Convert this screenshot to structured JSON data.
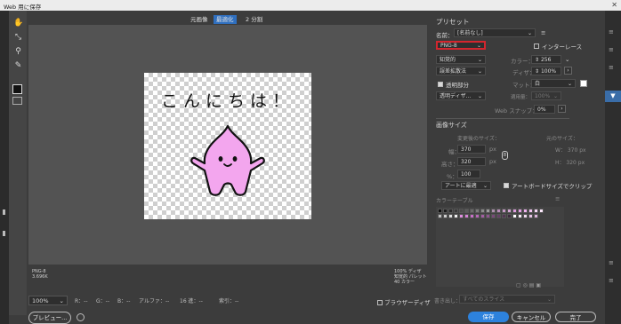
{
  "window": {
    "title": "Web 用に保存",
    "close": "✕"
  },
  "tabs": [
    {
      "label": "元画像",
      "active": false
    },
    {
      "label": "最適化",
      "active": true
    },
    {
      "label": "2 分割",
      "active": false
    }
  ],
  "canvas": {
    "greeting": "こんにちは！"
  },
  "original_info": {
    "line1": "PNG-8",
    "line2": "3.696K"
  },
  "optimized_info": {
    "line1": "100% ディザ",
    "line2": "知覚的 パレット",
    "line3": "40 カラー"
  },
  "bottom": {
    "zoom": "100%",
    "readouts": {
      "r": "R：--",
      "g": "G：--",
      "b": "B：--",
      "alpha": "アルファ：--",
      "hex": "16 進：--",
      "index": "索引：--"
    },
    "preview_label": "プレビュー...",
    "browser_dither": "ブラウザーディザ"
  },
  "preset": {
    "header": "プリセット",
    "name_label": "名前：",
    "name_value": "[名前なし]",
    "format": "PNG-8",
    "interlace": "インターレース",
    "reduction": "知覚的",
    "colors_label": "カラー：",
    "colors_value": "256",
    "dither_algo": "誤差拡散法",
    "dither_label": "ディザ：",
    "dither_value": "100%",
    "transparency": "透明部分",
    "matte_label": "マット：",
    "matte_value": "白",
    "trans_dither": "透明ディザ...",
    "amount_label": "適用量：",
    "amount_value": "100%",
    "web_snap_label": "Web スナップ：",
    "web_snap_value": "0%"
  },
  "image_size": {
    "header": "画像サイズ",
    "new_size": "変更後のサイズ：",
    "orig_size": "元のサイズ：",
    "width_label": "幅：",
    "width_value": "370",
    "height_label": "高さ：",
    "height_value": "320",
    "percent_label": "%：",
    "percent_value": "100",
    "unit": "px",
    "orig_w": "W： 370 px",
    "orig_h": "H： 320 px",
    "clip_option": "アートに最適",
    "clip_artboard": "アートボードサイズでクリップ"
  },
  "color_table": {
    "header": "カラーテーブル",
    "swatches": [
      "#0d0d0d",
      "#1a1a1a",
      "#2a2a2a",
      "#3a3a3a",
      "#4a4a4a",
      "#5a5a5a",
      "#6b6b6b",
      "#7b7b7b",
      "#8c8c8c",
      "#9c9c9c",
      "#ad8fad",
      "#b98db9",
      "#c79ac7",
      "#d3a6d3",
      "#de9bde",
      "#e59fe5",
      "#eeb0ee",
      "#f2c6f2",
      "#f6d6f6",
      "#fbe8fb",
      "#bfbfbf",
      "#cfcfcf",
      "#e0e0e0",
      "#f0f0f0",
      "#e08ee0",
      "#d683d6",
      "#c96fc9",
      "#b867b8",
      "#a45ea4",
      "#8f548f",
      "#7a4a7a",
      "#664066",
      "#523552",
      "#3d2a3d",
      "#ffffff",
      "#f7eef7",
      "#efd9ef",
      "#e7c4e7",
      "#dcb3dc"
    ]
  },
  "footer": {
    "slice_label": "書き出し：",
    "slice_value": "すべてのスライス",
    "save": "保存",
    "cancel": "キャンセル",
    "done": "完了"
  }
}
